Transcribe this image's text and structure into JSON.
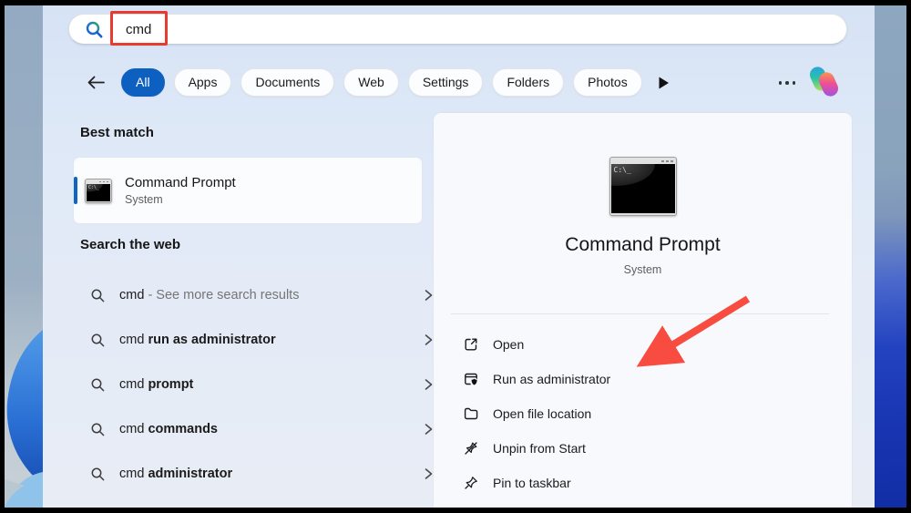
{
  "search": {
    "value": "cmd",
    "icon": "search-magnifier"
  },
  "tabs": [
    {
      "label": "All",
      "active": true
    },
    {
      "label": "Apps",
      "active": false
    },
    {
      "label": "Documents",
      "active": false
    },
    {
      "label": "Web",
      "active": false
    },
    {
      "label": "Settings",
      "active": false
    },
    {
      "label": "Folders",
      "active": false
    },
    {
      "label": "Photos",
      "active": false
    }
  ],
  "more_label": "more-options",
  "left": {
    "best_match_heading": "Best match",
    "best_match": {
      "title": "Command Prompt",
      "subtitle": "System"
    },
    "web_heading": "Search the web",
    "suggestions": [
      {
        "query": "cmd",
        "suffix": "- See more search results",
        "style": "muted"
      },
      {
        "query": "cmd",
        "suffix": "run as administrator",
        "style": "bold"
      },
      {
        "query": "cmd",
        "suffix": "prompt",
        "style": "bold"
      },
      {
        "query": "cmd",
        "suffix": "commands",
        "style": "bold"
      },
      {
        "query": "cmd",
        "suffix": "administrator",
        "style": "bold"
      }
    ]
  },
  "right": {
    "app_title": "Command Prompt",
    "app_subtitle": "System",
    "app_icon_text": "C:\\_",
    "actions": [
      {
        "label": "Open",
        "icon": "open-icon"
      },
      {
        "label": "Run as administrator",
        "icon": "run-as-administrator-icon"
      },
      {
        "label": "Open file location",
        "icon": "open-file-location-icon"
      },
      {
        "label": "Unpin from Start",
        "icon": "unpin-from-start-icon"
      },
      {
        "label": "Pin to taskbar",
        "icon": "pin-to-taskbar-icon"
      }
    ]
  },
  "annotations": {
    "highlight_box_color": "#e83a2e",
    "arrow_color": "#f74c3f",
    "arrow_target": "Run as administrator"
  },
  "colors": {
    "accent_blue": "#0e60c0",
    "window_bg_top": "#d6e3f5",
    "detail_card_bg": "#f7f9fd",
    "wallpaper_deep_blue": "#1834b0"
  }
}
